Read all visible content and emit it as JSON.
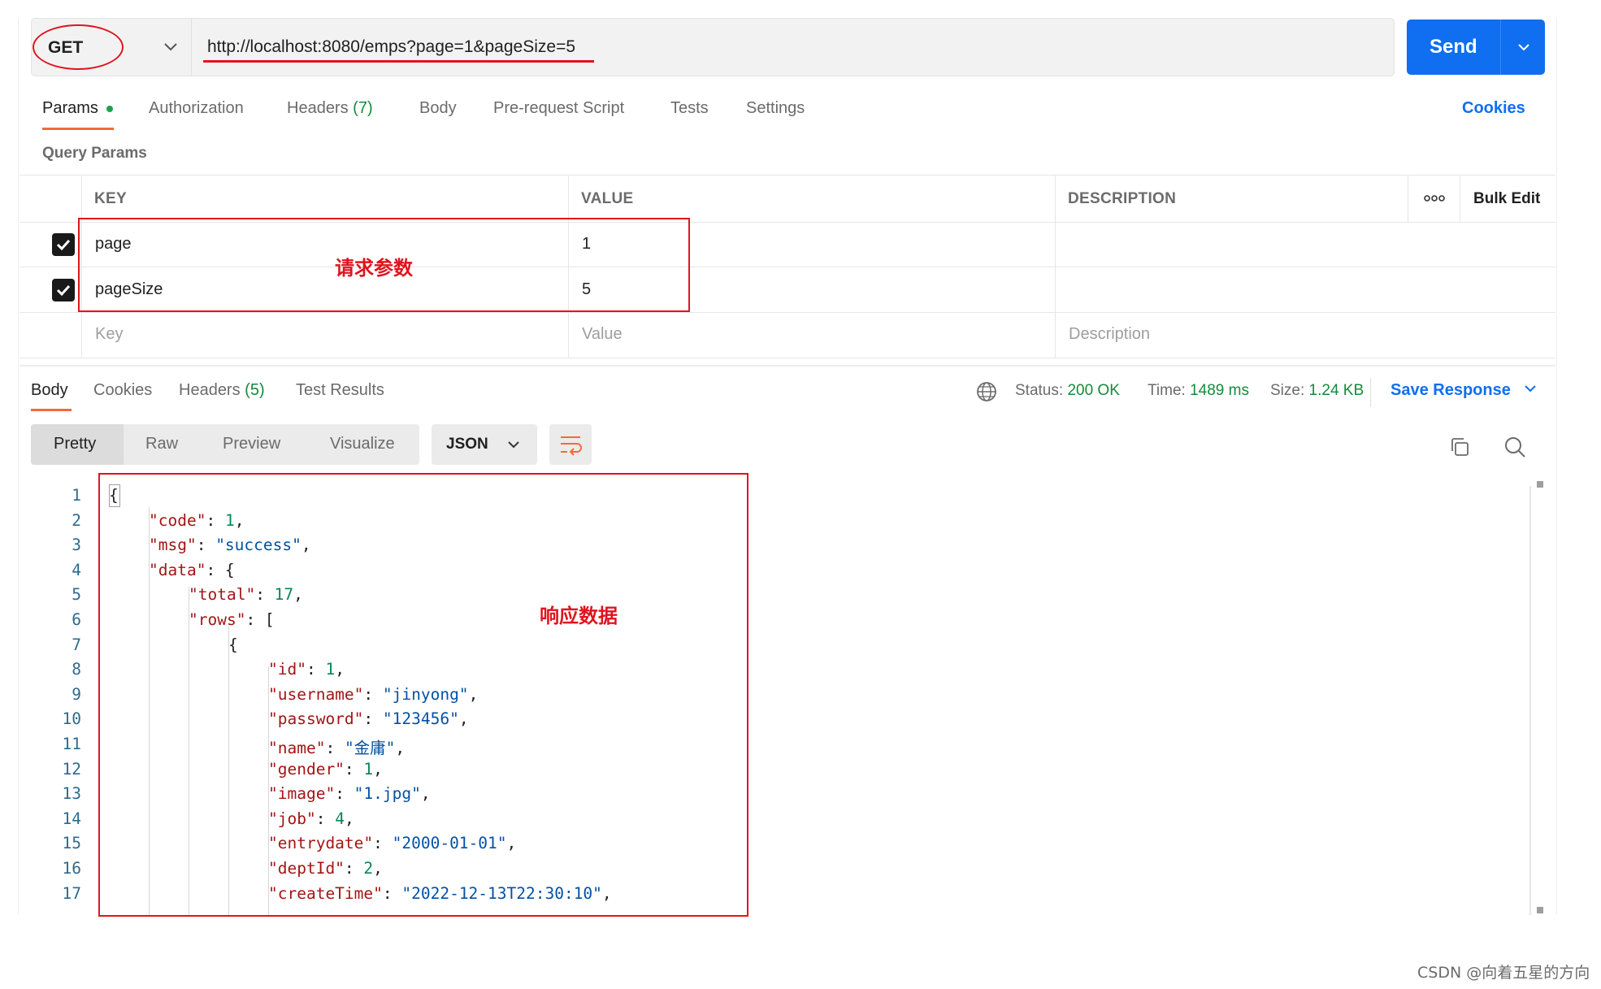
{
  "request": {
    "method": "GET",
    "url": "http://localhost:8080/emps?page=1&pageSize=5",
    "send_label": "Send"
  },
  "request_tabs": {
    "params": "Params",
    "authorization": "Authorization",
    "headers": "Headers",
    "headers_count": "(7)",
    "body": "Body",
    "pre_request_script": "Pre-request Script",
    "tests": "Tests",
    "settings": "Settings",
    "cookies": "Cookies"
  },
  "query_params": {
    "title": "Query Params",
    "headers": {
      "key": "KEY",
      "value": "VALUE",
      "description": "DESCRIPTION",
      "bulk_edit": "Bulk Edit"
    },
    "rows": [
      {
        "checked": true,
        "key": "page",
        "value": "1"
      },
      {
        "checked": true,
        "key": "pageSize",
        "value": "5"
      }
    ],
    "placeholder": {
      "key": "Key",
      "value": "Value",
      "description": "Description"
    }
  },
  "annotations": {
    "params_label": "请求参数",
    "response_label": "响应数据"
  },
  "response_tabs": {
    "body": "Body",
    "cookies": "Cookies",
    "headers": "Headers",
    "headers_count": "(5)",
    "test_results": "Test Results"
  },
  "response_status": {
    "status_label": "Status:",
    "status_value": "200 OK",
    "time_label": "Time:",
    "time_value": "1489 ms",
    "size_label": "Size:",
    "size_value": "1.24 KB",
    "save_response": "Save Response"
  },
  "view_tabs": {
    "pretty": "Pretty",
    "raw": "Raw",
    "preview": "Preview",
    "visualize": "Visualize",
    "format": "JSON"
  },
  "code_lines": [
    {
      "n": "1",
      "indent": 0,
      "parts": [
        [
          "p",
          "{"
        ]
      ]
    },
    {
      "n": "2",
      "indent": 1,
      "parts": [
        [
          "k",
          "\"code\""
        ],
        [
          "p",
          ": "
        ],
        [
          "n",
          "1"
        ],
        [
          "p",
          ","
        ]
      ]
    },
    {
      "n": "3",
      "indent": 1,
      "parts": [
        [
          "k",
          "\"msg\""
        ],
        [
          "p",
          ": "
        ],
        [
          "s",
          "\"success\""
        ],
        [
          "p",
          ","
        ]
      ]
    },
    {
      "n": "4",
      "indent": 1,
      "parts": [
        [
          "k",
          "\"data\""
        ],
        [
          "p",
          ": {"
        ]
      ]
    },
    {
      "n": "5",
      "indent": 2,
      "parts": [
        [
          "k",
          "\"total\""
        ],
        [
          "p",
          ": "
        ],
        [
          "n",
          "17"
        ],
        [
          "p",
          ","
        ]
      ]
    },
    {
      "n": "6",
      "indent": 2,
      "parts": [
        [
          "k",
          "\"rows\""
        ],
        [
          "p",
          ": ["
        ]
      ]
    },
    {
      "n": "7",
      "indent": 3,
      "parts": [
        [
          "p",
          "{"
        ]
      ]
    },
    {
      "n": "8",
      "indent": 4,
      "parts": [
        [
          "k",
          "\"id\""
        ],
        [
          "p",
          ": "
        ],
        [
          "n",
          "1"
        ],
        [
          "p",
          ","
        ]
      ]
    },
    {
      "n": "9",
      "indent": 4,
      "parts": [
        [
          "k",
          "\"username\""
        ],
        [
          "p",
          ": "
        ],
        [
          "s",
          "\"jinyong\""
        ],
        [
          "p",
          ","
        ]
      ]
    },
    {
      "n": "10",
      "indent": 4,
      "parts": [
        [
          "k",
          "\"password\""
        ],
        [
          "p",
          ": "
        ],
        [
          "s",
          "\"123456\""
        ],
        [
          "p",
          ","
        ]
      ]
    },
    {
      "n": "11",
      "indent": 4,
      "parts": [
        [
          "k",
          "\"name\""
        ],
        [
          "p",
          ": "
        ],
        [
          "s",
          "\"金庸\""
        ],
        [
          "p",
          ","
        ]
      ]
    },
    {
      "n": "12",
      "indent": 4,
      "parts": [
        [
          "k",
          "\"gender\""
        ],
        [
          "p",
          ": "
        ],
        [
          "n",
          "1"
        ],
        [
          "p",
          ","
        ]
      ]
    },
    {
      "n": "13",
      "indent": 4,
      "parts": [
        [
          "k",
          "\"image\""
        ],
        [
          "p",
          ": "
        ],
        [
          "s",
          "\"1.jpg\""
        ],
        [
          "p",
          ","
        ]
      ]
    },
    {
      "n": "14",
      "indent": 4,
      "parts": [
        [
          "k",
          "\"job\""
        ],
        [
          "p",
          ": "
        ],
        [
          "n",
          "4"
        ],
        [
          "p",
          ","
        ]
      ]
    },
    {
      "n": "15",
      "indent": 4,
      "parts": [
        [
          "k",
          "\"entrydate\""
        ],
        [
          "p",
          ": "
        ],
        [
          "s",
          "\"2000-01-01\""
        ],
        [
          "p",
          ","
        ]
      ]
    },
    {
      "n": "16",
      "indent": 4,
      "parts": [
        [
          "k",
          "\"deptId\""
        ],
        [
          "p",
          ": "
        ],
        [
          "n",
          "2"
        ],
        [
          "p",
          ","
        ]
      ]
    },
    {
      "n": "17",
      "indent": 4,
      "parts": [
        [
          "k",
          "\"createTime\""
        ],
        [
          "p",
          ": "
        ],
        [
          "s",
          "\"2022-12-13T22:30:10\""
        ],
        [
          "p",
          ","
        ]
      ]
    }
  ],
  "watermark": "CSDN @向着五星的方向",
  "colors": {
    "accent_blue": "#0f6ff0",
    "tab_underline": "#f26b3a",
    "success_green": "#148a3c",
    "annotation_red": "#e0141e",
    "json_key": "#a31515",
    "json_string": "#0451a5",
    "json_number": "#098658"
  },
  "icons": {
    "method_dropdown": "chevron-down-icon",
    "send_dropdown": "chevron-down-icon",
    "more_options": "more-horizontal-icon",
    "network": "globe-icon",
    "save_dropdown": "chevron-down-icon",
    "wrap": "wrap-lines-icon",
    "copy": "copy-icon",
    "search": "search-icon"
  }
}
